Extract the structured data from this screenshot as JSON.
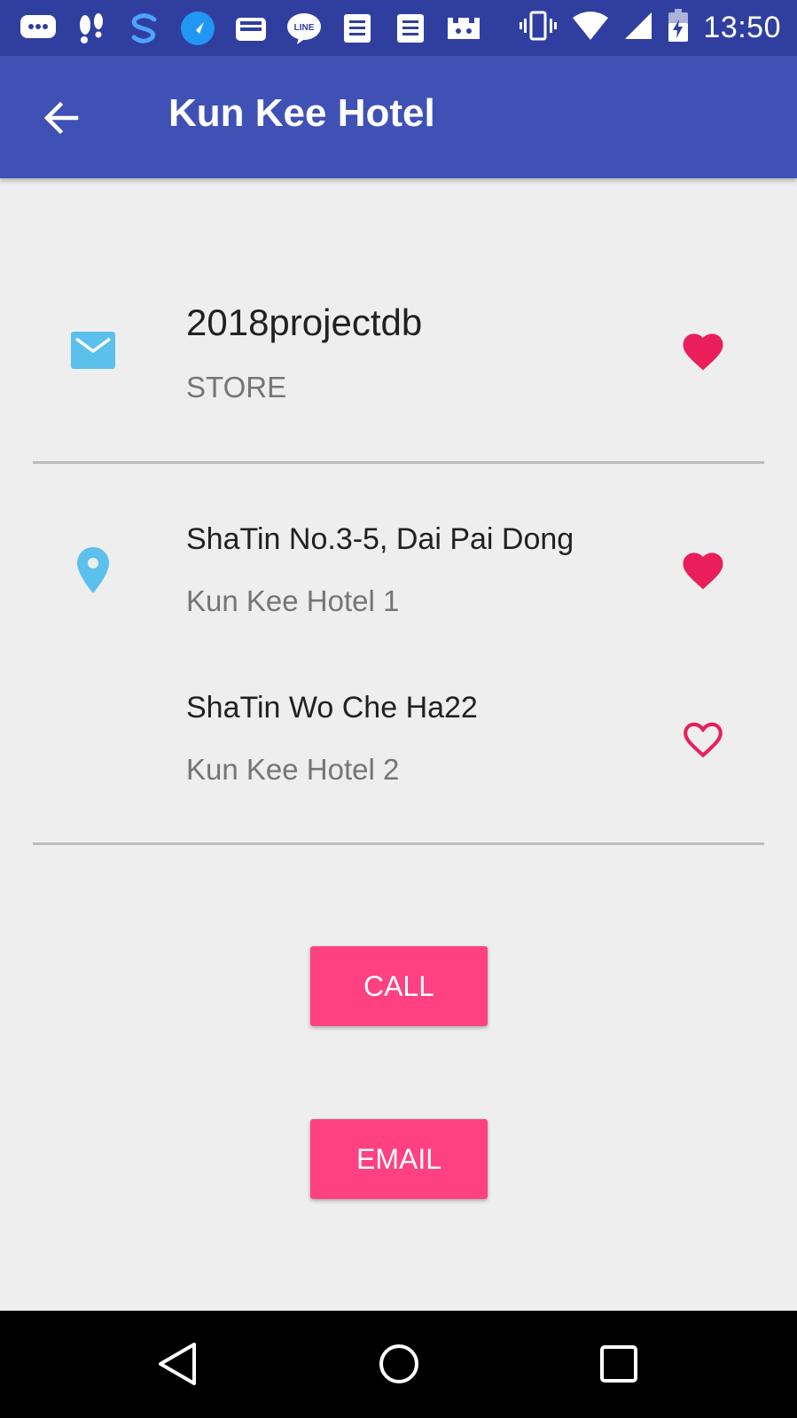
{
  "status_bar": {
    "time": "13:50",
    "left_icons": [
      "chat-bubble-icon",
      "footprints-icon",
      "s-app-icon",
      "rocket-icon",
      "inbox-icon",
      "line-app-icon",
      "document-icon",
      "document-icon",
      "castle-icon"
    ],
    "right_icons": [
      "vibrate-icon",
      "wifi-icon",
      "cell-signal-icon",
      "battery-charging-icon"
    ]
  },
  "app_bar": {
    "title": "Kun Kee Hotel"
  },
  "store": {
    "name": "2018projectdb",
    "type": "STORE",
    "favorited": true
  },
  "locations": [
    {
      "address": "ShaTin No.3-5, Dai Pai Dong",
      "name": "Kun Kee Hotel 1",
      "favorited": true
    },
    {
      "address": "ShaTin Wo Che Ha22",
      "name": "Kun Kee Hotel 2",
      "favorited": false
    }
  ],
  "actions": {
    "call_label": "CALL",
    "email_label": "EMAIL"
  },
  "colors": {
    "primary": "#3f51b5",
    "primary_dark": "#303f9f",
    "accent": "#ff4081",
    "heart": "#e91e5a",
    "icon_blue": "#5bc0eb"
  }
}
